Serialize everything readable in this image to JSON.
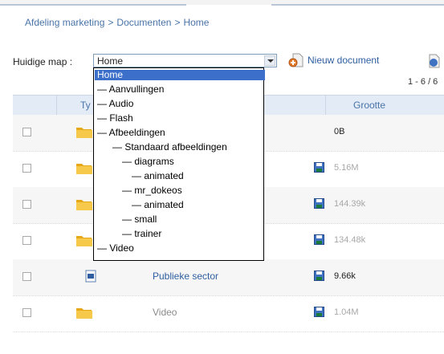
{
  "breadcrumb": [
    "Afdeling marketing",
    "Documenten",
    "Home"
  ],
  "breadcrumb_separator": ">",
  "folder_picker": {
    "label": "Huidige map :",
    "selected": "Home",
    "options": [
      {
        "label": "Home",
        "indent": 0,
        "prefix": ""
      },
      {
        "label": "Aanvullingen",
        "indent": 0,
        "prefix": "—"
      },
      {
        "label": "Audio",
        "indent": 0,
        "prefix": "—"
      },
      {
        "label": "Flash",
        "indent": 0,
        "prefix": "—"
      },
      {
        "label": "Afbeeldingen",
        "indent": 0,
        "prefix": "—"
      },
      {
        "label": "Standaard afbeeldingen",
        "indent": 1,
        "prefix": "—"
      },
      {
        "label": "diagrams",
        "indent": 2,
        "prefix": "—"
      },
      {
        "label": "animated",
        "indent": 3,
        "prefix": "—"
      },
      {
        "label": "mr_dokeos",
        "indent": 2,
        "prefix": "—"
      },
      {
        "label": "animated",
        "indent": 3,
        "prefix": "—"
      },
      {
        "label": "small",
        "indent": 2,
        "prefix": "—"
      },
      {
        "label": "trainer",
        "indent": 2,
        "prefix": "—"
      },
      {
        "label": "Video",
        "indent": 0,
        "prefix": "—"
      }
    ]
  },
  "toolbar": {
    "new_document": "Nieuw document"
  },
  "pagination": "1 - 6 / 6",
  "table": {
    "headers": {
      "type": "Ty",
      "size": "Grootte"
    },
    "rows": [
      {
        "name": "",
        "size": "0B",
        "type": "folder",
        "muted": false,
        "save": false
      },
      {
        "name": "",
        "size": "5.16M",
        "type": "folder",
        "muted": true,
        "save": true
      },
      {
        "name": "",
        "size": "144.39k",
        "type": "folder",
        "muted": true,
        "save": true
      },
      {
        "name": "",
        "size": "134.48k",
        "type": "folder",
        "muted": true,
        "save": true
      },
      {
        "name": "Publieke sector",
        "size": "9.66k",
        "type": "document",
        "muted": false,
        "save": true
      },
      {
        "name": "Video",
        "size": "1.04M",
        "type": "folder",
        "muted": true,
        "save": true
      }
    ]
  },
  "colors": {
    "link": "#2f5fa0",
    "selection": "#3b6fc9",
    "header_bg": "#e3ebf6",
    "folder": "#f5c542"
  }
}
